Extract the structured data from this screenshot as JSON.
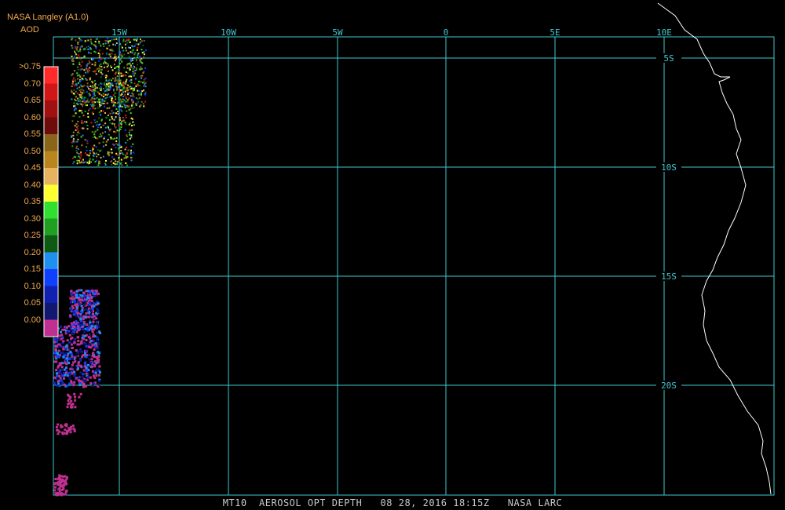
{
  "legend": {
    "source": "NASA Langley (A1.0)",
    "variable": "AOD",
    "labels": [
      ">0.75",
      "0.70",
      "0.65",
      "0.60",
      "0.55",
      "0.50",
      "0.45",
      "0.40",
      "0.35",
      "0.30",
      "0.25",
      "0.20",
      "0.15",
      "0.10",
      "0.05",
      "0.00"
    ],
    "colors": [
      "#ff2a2a",
      "#d01616",
      "#a01010",
      "#6e0c0c",
      "#8a6418",
      "#b8861c",
      "#e6b460",
      "#ffff30",
      "#30e030",
      "#20a020",
      "#0e5a14",
      "#2090f0",
      "#1040ff",
      "#1020b0",
      "#101870",
      "#c03090"
    ]
  },
  "map": {
    "line_color": "#40c8d0",
    "coast_color": "#ffffff",
    "lon_labels": [
      "15W",
      "10W",
      "5W",
      "0",
      "5E",
      "10E"
    ],
    "lat_labels": [
      "5S",
      "10S",
      "15S",
      "20S"
    ]
  },
  "footer": "MT10  AEROSOL OPT DEPTH   08 28, 2016 18:15Z   NASA LARC"
}
